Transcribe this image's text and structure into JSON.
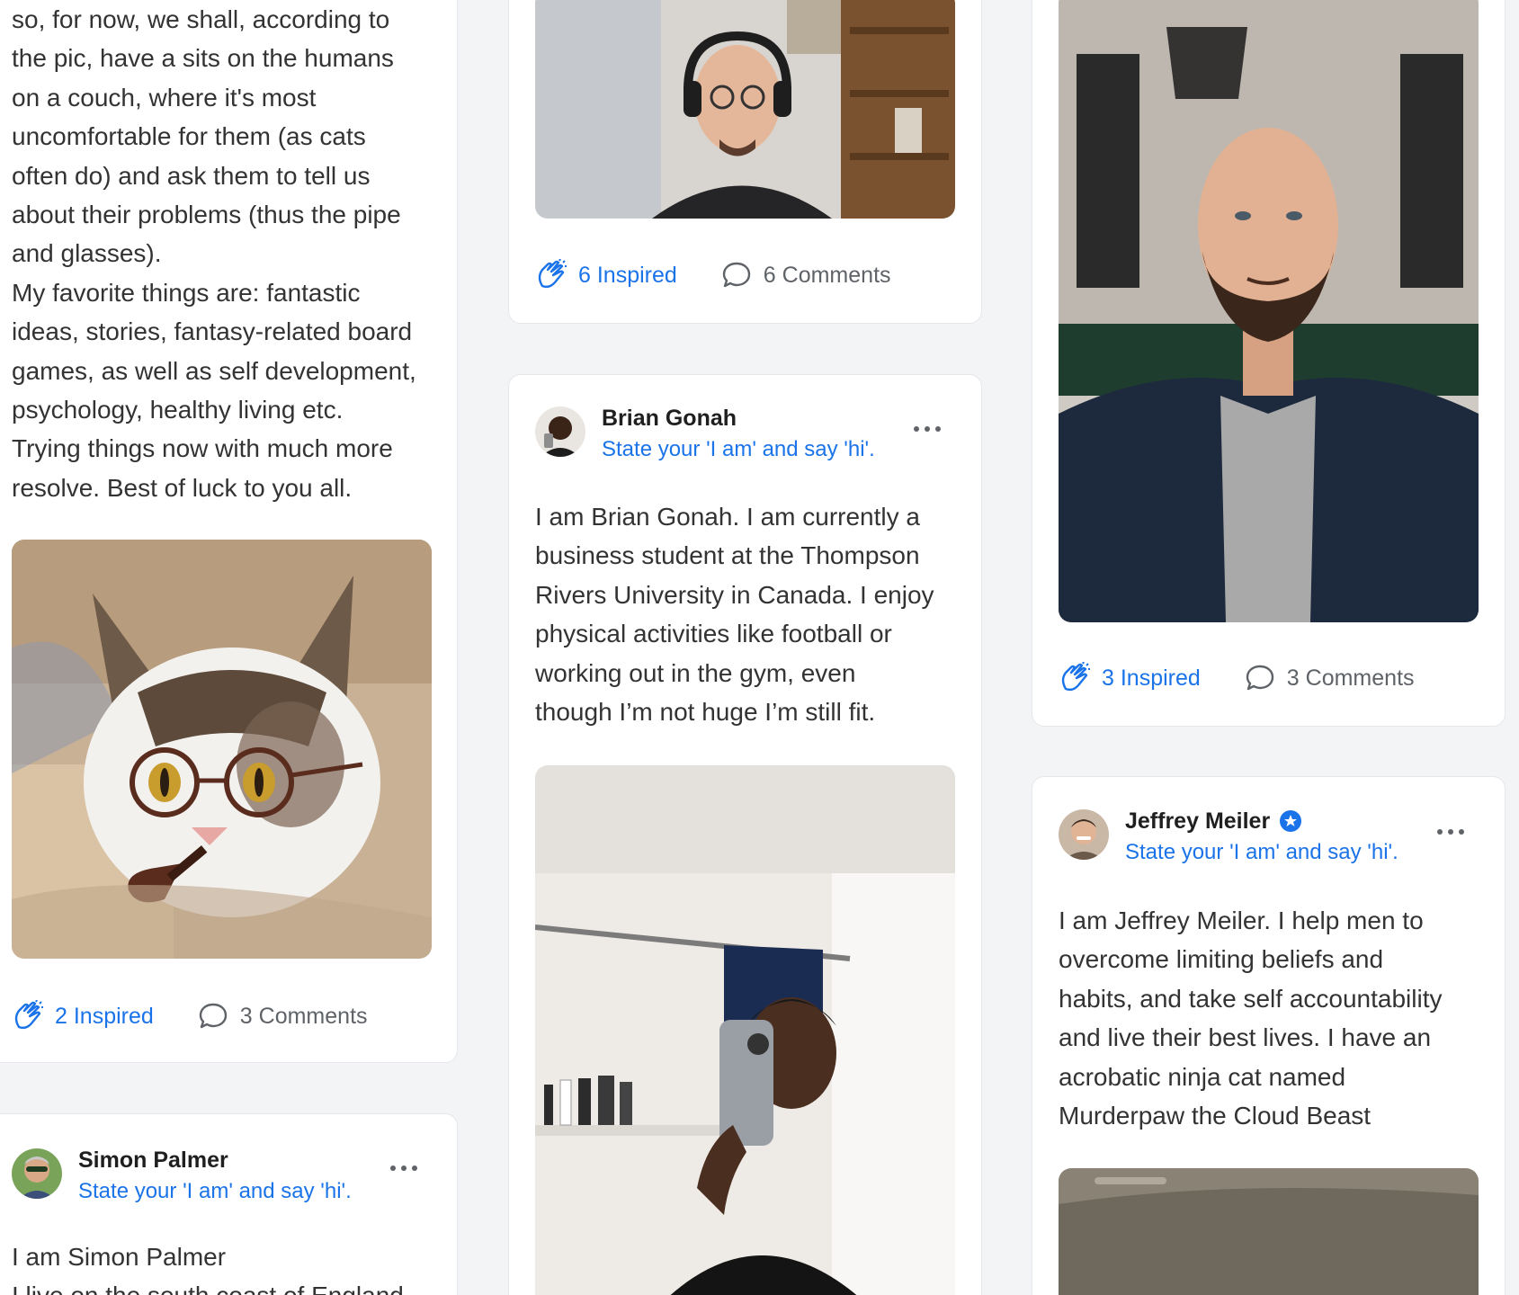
{
  "colors": {
    "accent": "#1a73e8",
    "muted": "#5f6368",
    "card_border": "#e6e7ea",
    "page_bg": "#f3f4f6"
  },
  "col1": {
    "bio_lines": [
      "so, for now, we shall, according to",
      "the pic, have a sits on the humans",
      "on a couch, where it's most",
      "uncomfortable for them (as cats",
      "often do) and ask them to tell us",
      "about their problems (thus the pipe",
      "and glasses).",
      "My favorite things are: fantastic",
      "ideas, stories, fantasy-related board",
      "games, as well as self development,",
      "psychology, healthy living etc.",
      "Trying things now with much more",
      "resolve. Best of luck to you all."
    ],
    "inspired": "2 Inspired",
    "comments": "3 Comments",
    "next_post": {
      "author": "Simon Palmer",
      "tagline": "State your 'I am' and say 'hi'.",
      "body_lines": [
        "I am Simon Palmer",
        "I live on the south coast of England"
      ]
    }
  },
  "col2": {
    "inspired": "6 Inspired",
    "comments": "6 Comments",
    "post": {
      "author": "Brian Gonah",
      "tagline": "State your 'I am' and say 'hi'.",
      "body_lines": [
        "I am Brian Gonah. I am currently a",
        "business student at the Thompson",
        "Rivers University in Canada. I enjoy",
        "physical activities like football or",
        "working out in the gym, even",
        "though I’m not huge I’m still fit."
      ]
    }
  },
  "col3": {
    "inspired": "3 Inspired",
    "comments": "3 Comments",
    "post": {
      "author": "Jeffrey Meiler",
      "verified": true,
      "tagline": "State your 'I am' and say 'hi'.",
      "body_lines": [
        "I am Jeffrey Meiler. I help men to",
        "overcome limiting beliefs and",
        "habits, and take self accountability",
        "and live their best lives. I have an",
        "acrobatic ninja cat named",
        "Murderpaw the Cloud Beast"
      ]
    }
  },
  "icons": {
    "clap": "clap-icon",
    "comment": "comment-bubble-icon",
    "more": "more-options-icon",
    "verified": "verified-badge-icon"
  }
}
